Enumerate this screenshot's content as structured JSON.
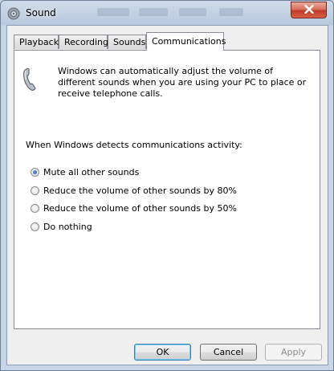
{
  "window": {
    "title": "Sound"
  },
  "tabs": [
    {
      "label": "Playback"
    },
    {
      "label": "Recording"
    },
    {
      "label": "Sounds"
    },
    {
      "label": "Communications"
    }
  ],
  "active_tab": "Communications",
  "communications": {
    "description": "Windows can automatically adjust the volume of different sounds when you are using your PC to place or receive telephone calls.",
    "prompt": "When Windows detects communications activity:",
    "options": [
      {
        "label": "Mute all other sounds",
        "selected": true
      },
      {
        "label": "Reduce the volume of other sounds by 80%",
        "selected": false
      },
      {
        "label": "Reduce the volume of other sounds by 50%",
        "selected": false
      },
      {
        "label": "Do nothing",
        "selected": false
      }
    ]
  },
  "buttons": {
    "ok": "OK",
    "cancel": "Cancel",
    "apply": "Apply"
  },
  "icons": {
    "app": "speaker-icon",
    "close": "close-icon",
    "info": "telephone-icon"
  },
  "colors": {
    "close_button": "#c0392b",
    "default_button_border": "#3c7fb1",
    "selected_radio": "#184f9c"
  }
}
